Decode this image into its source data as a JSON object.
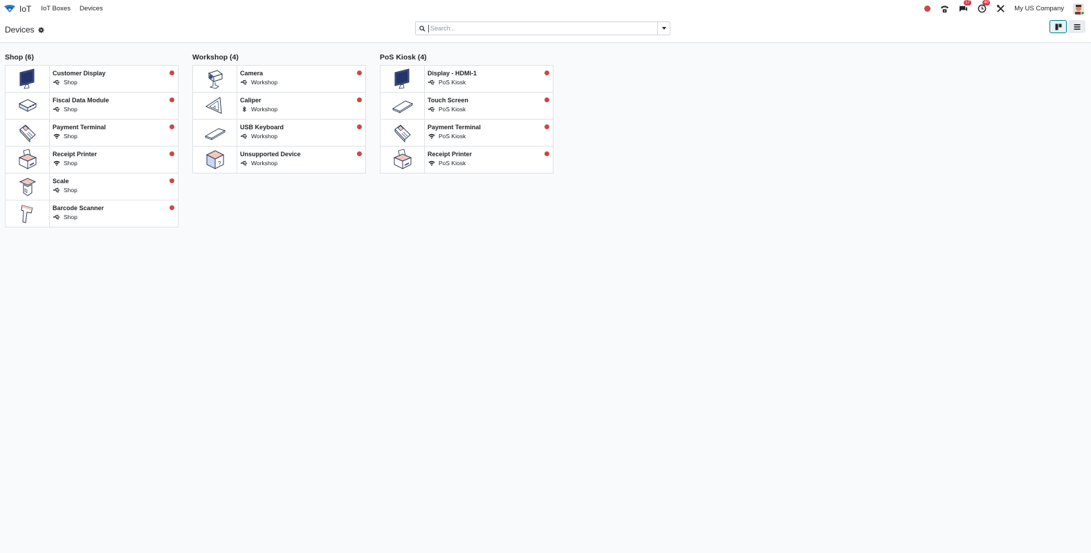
{
  "app": {
    "name": "IoT"
  },
  "nav": {
    "items": [
      "IoT Boxes",
      "Devices"
    ]
  },
  "systray": {
    "messages_badge": "17",
    "activities_badge": "40",
    "company": "My US Company"
  },
  "control_panel": {
    "title": "Devices",
    "search_placeholder": "Search..."
  },
  "columns": [
    {
      "header": "Shop (6)",
      "cards": [
        {
          "name": "Customer Display",
          "location": "Shop",
          "connection": "usb",
          "icon": "monitor-icon"
        },
        {
          "name": "Fiscal Data Module",
          "location": "Shop",
          "connection": "usb",
          "icon": "fiscal-module-icon"
        },
        {
          "name": "Payment Terminal",
          "location": "Shop",
          "connection": "wifi",
          "icon": "payment-terminal-icon"
        },
        {
          "name": "Receipt Printer",
          "location": "Shop",
          "connection": "wifi",
          "icon": "printer-icon"
        },
        {
          "name": "Scale",
          "location": "Shop",
          "connection": "usb",
          "icon": "scale-icon"
        },
        {
          "name": "Barcode Scanner",
          "location": "Shop",
          "connection": "usb",
          "icon": "barcode-scanner-icon"
        }
      ]
    },
    {
      "header": "Workshop (4)",
      "cards": [
        {
          "name": "Camera",
          "location": "Workshop",
          "connection": "usb",
          "icon": "camera-icon"
        },
        {
          "name": "Caliper",
          "location": "Workshop",
          "connection": "bluetooth",
          "icon": "caliper-icon"
        },
        {
          "name": "USB Keyboard",
          "location": "Workshop",
          "connection": "usb",
          "icon": "keyboard-icon"
        },
        {
          "name": "Unsupported Device",
          "location": "Workshop",
          "connection": "usb",
          "icon": "unknown-device-icon"
        }
      ]
    },
    {
      "header": "PoS Kiosk (4)",
      "cards": [
        {
          "name": "Display - HDMI-1",
          "location": "PoS Kiosk",
          "connection": "usb",
          "icon": "monitor-icon"
        },
        {
          "name": "Touch Screen",
          "location": "PoS Kiosk",
          "connection": "usb",
          "icon": "touch-screen-icon"
        },
        {
          "name": "Payment Terminal",
          "location": "PoS Kiosk",
          "connection": "wifi",
          "icon": "payment-terminal-icon"
        },
        {
          "name": "Receipt Printer",
          "location": "PoS Kiosk",
          "connection": "wifi",
          "icon": "printer-icon"
        }
      ]
    }
  ],
  "colors": {
    "status_dot": "#d04545",
    "accent": "#017e84",
    "badge": "#d33a4a"
  }
}
